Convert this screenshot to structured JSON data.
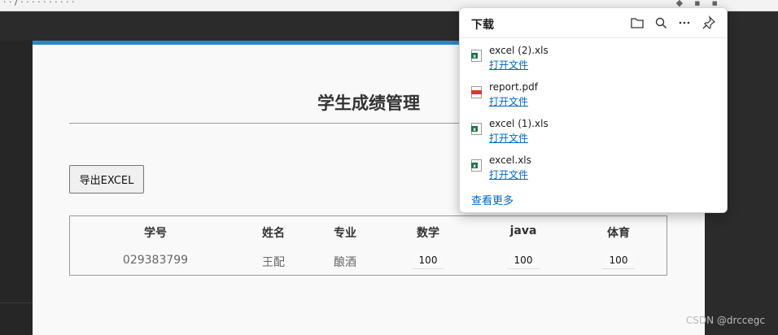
{
  "page": {
    "title": "学生成绩管理",
    "export_button": "导出EXCEL"
  },
  "table": {
    "headers": [
      "学号",
      "姓名",
      "专业",
      "数学",
      "java",
      "体育"
    ],
    "rows": [
      {
        "id": "029383799",
        "name": "王配",
        "major": "酿酒",
        "math": "100",
        "java": "100",
        "pe": "100"
      }
    ]
  },
  "downloads": {
    "title": "下载",
    "open_label": "打开文件",
    "see_more": "查看更多",
    "files": [
      {
        "name": "excel (2).xls",
        "type": "excel"
      },
      {
        "name": "report.pdf",
        "type": "pdf"
      },
      {
        "name": "excel (1).xls",
        "type": "excel"
      },
      {
        "name": "excel.xls",
        "type": "excel"
      }
    ],
    "icons": [
      "folder-icon",
      "search-icon",
      "more-icon",
      "pin-icon"
    ]
  },
  "watermark": "CSDN @drccegc",
  "colors": {
    "accent": "#2a87c8",
    "link": "#0067c0",
    "excel_green": "#1e7145",
    "pdf_red": "#d63a2f"
  }
}
